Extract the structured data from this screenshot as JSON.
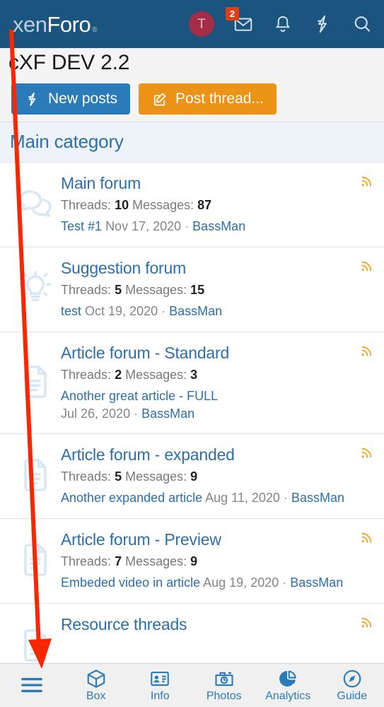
{
  "header": {
    "logo_thin": "xen",
    "logo_bold": "Foro",
    "logo_tm": "®",
    "avatar_initial": "T",
    "icons": [
      {
        "name": "inbox-icon",
        "badge": "2"
      },
      {
        "name": "alerts-bell-icon",
        "badge": ""
      },
      {
        "name": "whats-new-bolt-icon",
        "badge": ""
      },
      {
        "name": "search-icon",
        "badge": ""
      }
    ]
  },
  "page": {
    "title": "cXF DEV 2.2"
  },
  "toolbar": {
    "new_posts_label": "New posts",
    "post_thread_label": "Post thread..."
  },
  "category": {
    "title": "Main category"
  },
  "forums": [
    {
      "title": "Main forum",
      "icon": "comments-icon",
      "threads_label": "Threads:",
      "threads": "10",
      "messages_label": "Messages:",
      "messages": "87",
      "last_thread": "Test #1",
      "last_date": "Nov 17, 2020",
      "last_author": "BassMan",
      "wrap": false
    },
    {
      "title": "Suggestion forum",
      "icon": "lightbulb-icon",
      "threads_label": "Threads:",
      "threads": "5",
      "messages_label": "Messages:",
      "messages": "15",
      "last_thread": "test",
      "last_date": "Oct 19, 2020",
      "last_author": "BassMan",
      "wrap": false
    },
    {
      "title": "Article forum - Standard",
      "icon": "file-lines-icon",
      "threads_label": "Threads:",
      "threads": "2",
      "messages_label": "Messages:",
      "messages": "3",
      "last_thread": "Another great article - FULL",
      "last_date": "Jul 26, 2020",
      "last_author": "BassMan",
      "wrap": true
    },
    {
      "title": "Article forum - expanded",
      "icon": "file-lines-icon",
      "threads_label": "Threads:",
      "threads": "5",
      "messages_label": "Messages:",
      "messages": "9",
      "last_thread": "Another expanded article",
      "last_date": "Aug 11, 2020",
      "last_author": "BassMan",
      "wrap": false
    },
    {
      "title": "Article forum - Preview",
      "icon": "file-lines-icon",
      "threads_label": "Threads:",
      "threads": "7",
      "messages_label": "Messages:",
      "messages": "9",
      "last_thread": "Embeded video in article",
      "last_date": "Aug 19, 2020",
      "last_author": "BassMan",
      "wrap": false
    },
    {
      "title": "Resource threads",
      "icon": "file-lines-icon",
      "threads_label": "",
      "threads": "",
      "messages_label": "",
      "messages": "",
      "last_thread": "",
      "last_date": "",
      "last_author": "",
      "wrap": false
    }
  ],
  "bottom_nav": [
    {
      "label": "",
      "icon": "hamburger-menu-icon"
    },
    {
      "label": "Box",
      "icon": "box-icon"
    },
    {
      "label": "Info",
      "icon": "id-card-icon"
    },
    {
      "label": "Photos",
      "icon": "camera-icon"
    },
    {
      "label": "Analytics",
      "icon": "pie-chart-icon"
    },
    {
      "label": "Guide",
      "icon": "compass-icon"
    }
  ],
  "colors": {
    "header_blue": "#1c5480",
    "link_blue": "#2b6fab",
    "button_blue": "#2b7bb9",
    "button_orange": "#eb9316",
    "rss_orange": "#f5a31c",
    "badge_red": "#e03d12",
    "avatar_maroon": "#a62d47",
    "annotation_red": "#fa2600"
  },
  "annotation": {
    "type": "arrow",
    "points_to": "hamburger-menu-icon"
  }
}
